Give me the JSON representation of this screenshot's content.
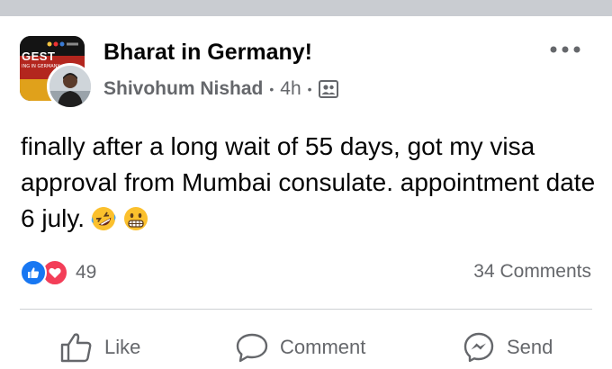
{
  "post": {
    "group_name": "Bharat in Germany!",
    "author": "Shivohum Nishad",
    "separator": "•",
    "time": "4h",
    "audience_icon": "members-icon",
    "more_icon": "more-dots-icon",
    "group_avatar_text": "GEST",
    "group_avatar_subtext": "ING IN GERMANY",
    "body": "finally after a long wait of 55 days, got my visa approval from Mumbai consulate. appointment date 6 july.",
    "emojis": [
      "rolling-on-floor-laughing-emoji",
      "grimacing-face-emoji"
    ]
  },
  "reactions": {
    "icons": [
      "like-reaction-icon",
      "love-reaction-icon"
    ],
    "count": "49"
  },
  "comments": {
    "label": "34 Comments"
  },
  "actions": {
    "like_label": "Like",
    "comment_label": "Comment",
    "send_label": "Send"
  },
  "colors": {
    "like_blue": "#1877f2",
    "love_red": "#f33e58",
    "secondary_text": "#65676b",
    "primary_text": "#050505",
    "divider": "#ced0d4",
    "top_strip": "#c9ccd1"
  }
}
